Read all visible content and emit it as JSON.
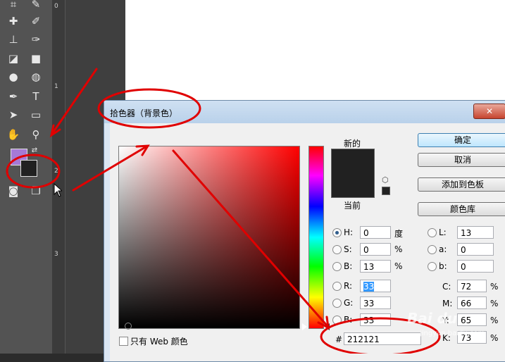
{
  "ruler": {
    "marks": [
      "0",
      "1",
      "2",
      "3"
    ]
  },
  "dialog": {
    "title": "拾色器（背景色）",
    "close_label": "✕",
    "new_label": "新的",
    "current_label": "当前",
    "buttons": {
      "ok": "确定",
      "cancel": "取消",
      "add_swatch": "添加到色板",
      "color_library": "颜色库"
    },
    "web_only_label": "只有 Web 颜色",
    "hsb": {
      "h_label": "H:",
      "h_value": "0",
      "h_unit": "度",
      "s_label": "S:",
      "s_value": "0",
      "s_unit": "%",
      "b_label": "B:",
      "b_value": "13",
      "b_unit": "%"
    },
    "rgb": {
      "r_label": "R:",
      "r_value": "33",
      "g_label": "G:",
      "g_value": "33",
      "b_label": "B:",
      "b_value": "33"
    },
    "lab": {
      "l_label": "L:",
      "l_value": "13",
      "a_label": "a:",
      "a_value": "0",
      "b_label": "b:",
      "b_value": "0"
    },
    "cmyk": {
      "c_label": "C:",
      "c_value": "72",
      "c_unit": "%",
      "m_label": "M:",
      "m_value": "66",
      "m_unit": "%",
      "y_label": "Y:",
      "y_value": "65",
      "y_unit": "%",
      "k_label": "K:",
      "k_value": "73",
      "k_unit": "%"
    },
    "hex_label": "#",
    "hex_value": "212121"
  },
  "colors": {
    "foreground": "#a57ad6",
    "background": "#212121",
    "annotation": "#e00000"
  },
  "watermark": {
    "text": "Bai du",
    "sub": "jingyan.baidu.com"
  }
}
